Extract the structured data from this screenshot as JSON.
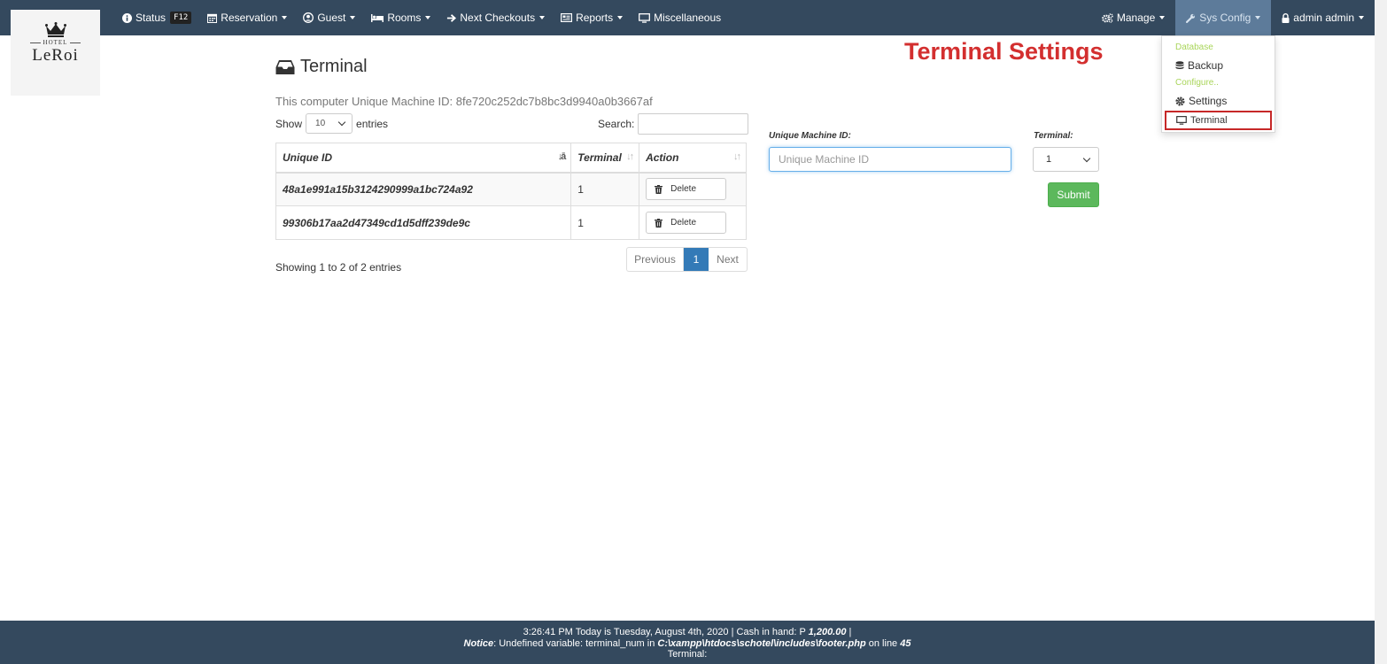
{
  "logo": {
    "line1": "HOTEL",
    "line2": "LeRoi"
  },
  "navbar": {
    "left": [
      {
        "label": "Status",
        "icon": "info-circle-icon",
        "kbd": "F12"
      },
      {
        "label": "Reservation",
        "icon": "calendar-icon"
      },
      {
        "label": "Guest",
        "icon": "user-circle-icon"
      },
      {
        "label": "Rooms",
        "icon": "bed-icon"
      },
      {
        "label": "Next Checkouts",
        "icon": "arrow-right-icon"
      },
      {
        "label": "Reports",
        "icon": "report-icon"
      },
      {
        "label": "Miscellaneous",
        "icon": "monitor-icon"
      }
    ],
    "right": [
      {
        "label": "Manage",
        "icon": "gears-icon"
      },
      {
        "label": "Sys Config",
        "icon": "wrench-icon"
      },
      {
        "label": "admin admin",
        "icon": "user-lock-icon"
      }
    ]
  },
  "dropdown": {
    "header_database": "Database",
    "item_backup": "Backup",
    "header_configure": "Configure..",
    "item_settings": "Settings",
    "item_terminal": "Terminal"
  },
  "annotation": "Terminal Settings",
  "page": {
    "title": "Terminal",
    "machine_id_text": "This computer Unique Machine ID: 8fe720c252dc7b8bc3d9940a0b3667af"
  },
  "table": {
    "show_label": "Show",
    "entries_label": "entries",
    "page_size": "10",
    "search_label": "Search:",
    "columns": [
      "Unique ID",
      "Terminal",
      "Action"
    ],
    "rows": [
      {
        "uid": "48a1e991a15b3124290999a1bc724a92",
        "terminal": "1",
        "action": "Delete"
      },
      {
        "uid": "99306b17aa2d47349cd1d5dff239de9c",
        "terminal": "1",
        "action": "Delete"
      }
    ],
    "info": "Showing 1 to 2 of 2 entries",
    "pager": {
      "prev": "Previous",
      "current": "1",
      "next": "Next"
    }
  },
  "form": {
    "uid_label": "Unique Machine ID:",
    "uid_placeholder": "Unique Machine ID",
    "terminal_label": "Terminal:",
    "terminal_value": "1",
    "submit": "Submit"
  },
  "footer": {
    "line1_pre": "3:26:41 PM Today is Tuesday, August 4th, 2020 | Cash in hand: P ",
    "cash": "1,200.00",
    "line1_post": " |",
    "notice_label": "Notice",
    "notice_text": ": Undefined variable: terminal_num in ",
    "notice_path": "C:\\xampp\\htdocs\\schotel\\includes\\footer.php",
    "notice_on_line": " on line ",
    "notice_line": "45",
    "line3": "Terminal:"
  },
  "colors": {
    "navbar": "#34495e",
    "annotation": "#d32f2f",
    "submit": "#5cb85c",
    "pager_active": "#337ab7",
    "dropdown_header": "#a9d55a"
  }
}
